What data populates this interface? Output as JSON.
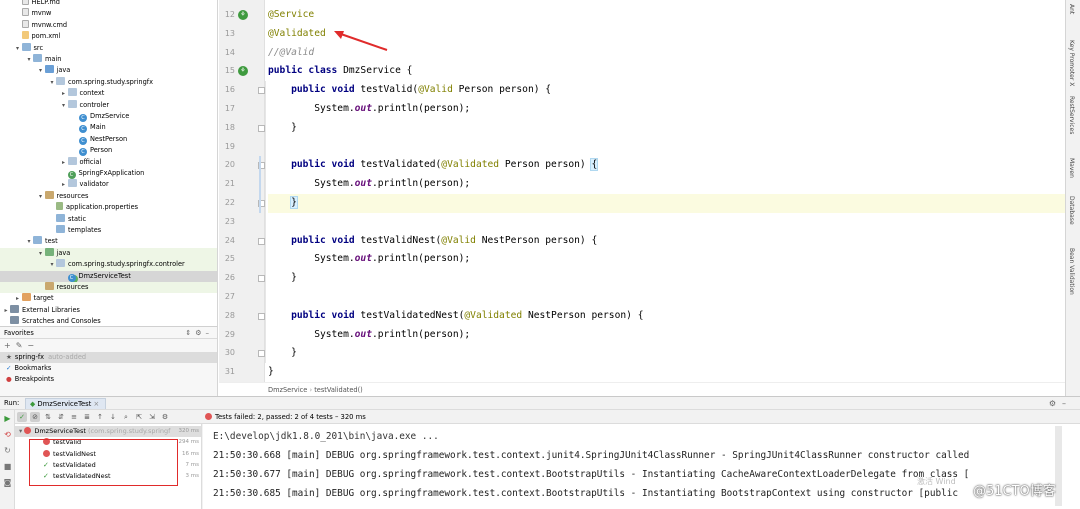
{
  "project_tree": [
    {
      "label": "HELP.md",
      "indent": 1,
      "icon": "file-icon",
      "arrow": ""
    },
    {
      "label": "mvnw",
      "indent": 1,
      "icon": "file-icon",
      "arrow": ""
    },
    {
      "label": "mvnw.cmd",
      "indent": 1,
      "icon": "file-icon",
      "arrow": ""
    },
    {
      "label": "pom.xml",
      "indent": 1,
      "icon": "xml-file-icon",
      "arrow": ""
    },
    {
      "label": "src",
      "indent": 1,
      "icon": "folder-icon",
      "arrow": "v"
    },
    {
      "label": "main",
      "indent": 2,
      "icon": "folder-icon",
      "arrow": "v"
    },
    {
      "label": "java",
      "indent": 3,
      "icon": "source-folder-icon",
      "arrow": "v"
    },
    {
      "label": "com.spring.study.springfx",
      "indent": 4,
      "icon": "package-icon",
      "arrow": "v"
    },
    {
      "label": "context",
      "indent": 5,
      "icon": "package-icon",
      "arrow": ">"
    },
    {
      "label": "controler",
      "indent": 5,
      "icon": "package-icon",
      "arrow": "v"
    },
    {
      "label": "DmzService",
      "indent": 6,
      "icon": "class-icon",
      "arrow": ""
    },
    {
      "label": "Main",
      "indent": 6,
      "icon": "class-icon",
      "arrow": ""
    },
    {
      "label": "NestPerson",
      "indent": 6,
      "icon": "class-icon",
      "arrow": ""
    },
    {
      "label": "Person",
      "indent": 6,
      "icon": "class-icon",
      "arrow": ""
    },
    {
      "label": "official",
      "indent": 5,
      "icon": "package-icon",
      "arrow": ">"
    },
    {
      "label": "SpringFxApplication",
      "indent": 5,
      "icon": "spring-class-icon",
      "arrow": ""
    },
    {
      "label": "validator",
      "indent": 5,
      "icon": "package-icon",
      "arrow": ">"
    },
    {
      "label": "resources",
      "indent": 3,
      "icon": "resources-folder-icon",
      "arrow": "v"
    },
    {
      "label": "application.properties",
      "indent": 4,
      "icon": "properties-file-icon",
      "arrow": ""
    },
    {
      "label": "static",
      "indent": 4,
      "icon": "folder-icon",
      "arrow": ""
    },
    {
      "label": "templates",
      "indent": 4,
      "icon": "folder-icon",
      "arrow": ""
    },
    {
      "label": "test",
      "indent": 2,
      "icon": "folder-icon",
      "arrow": "v"
    },
    {
      "label": "java",
      "indent": 3,
      "icon": "test-folder-icon",
      "arrow": "v",
      "highlight": "green"
    },
    {
      "label": "com.spring.study.springfx.controler",
      "indent": 4,
      "icon": "package-icon",
      "arrow": "v",
      "highlight": "green"
    },
    {
      "label": "DmzServiceTest",
      "indent": 5,
      "icon": "test-class-icon",
      "arrow": "",
      "highlight": "selected"
    },
    {
      "label": "resources",
      "indent": 3,
      "icon": "resources-folder-icon",
      "arrow": "",
      "highlight": "green"
    },
    {
      "label": "target",
      "indent": 1,
      "icon": "target-folder-icon",
      "arrow": ">"
    },
    {
      "label": "External Libraries",
      "indent": 0,
      "icon": "library-icon",
      "arrow": ">"
    },
    {
      "label": "Scratches and Consoles",
      "indent": 0,
      "icon": "scratches-icon",
      "arrow": ""
    }
  ],
  "favorites": {
    "title": "Favorites",
    "items": [
      {
        "label": "spring-fx",
        "suffix": "auto-added",
        "icon": "star-icon"
      },
      {
        "label": "Bookmarks",
        "suffix": "",
        "icon": "bookmark-check-icon"
      },
      {
        "label": "Breakpoints",
        "suffix": "",
        "icon": "breakpoint-icon"
      }
    ]
  },
  "editor": {
    "lines": [
      {
        "n": "12",
        "html": "<span class=\"ann\">@Service</span>"
      },
      {
        "n": "13",
        "html": "<span class=\"ann\">@Validated</span>"
      },
      {
        "n": "14",
        "html": "<span class=\"cmt\">//@Valid</span>"
      },
      {
        "n": "15",
        "html": "<span class=\"kw\">public class</span> DmzService {"
      },
      {
        "n": "16",
        "html": "    <span class=\"kw\">public void</span> testValid(<span class=\"ann\">@Valid</span> Person person) {"
      },
      {
        "n": "17",
        "html": "        System.<span class=\"fld\">out</span>.println(person);"
      },
      {
        "n": "18",
        "html": "    }"
      },
      {
        "n": "19",
        "html": ""
      },
      {
        "n": "20",
        "html": "    <span class=\"kw\">public void</span> testValidated(<span class=\"ann\">@Validated</span> Person person) <span class=\"brace-hl\">{</span>"
      },
      {
        "n": "21",
        "html": "        System.<span class=\"fld\">out</span>.println(person);"
      },
      {
        "n": "22",
        "html": "    <span class=\"brace-hl\">}</span>",
        "current": true
      },
      {
        "n": "23",
        "html": ""
      },
      {
        "n": "24",
        "html": "    <span class=\"kw\">public void</span> testValidNest(<span class=\"ann\">@Valid</span> NestPerson person) {"
      },
      {
        "n": "25",
        "html": "        System.<span class=\"fld\">out</span>.println(person);"
      },
      {
        "n": "26",
        "html": "    }"
      },
      {
        "n": "27",
        "html": ""
      },
      {
        "n": "28",
        "html": "    <span class=\"kw\">public void</span> testValidatedNest(<span class=\"ann\">@Validated</span> NestPerson person) {"
      },
      {
        "n": "29",
        "html": "        System.<span class=\"fld\">out</span>.println(person);"
      },
      {
        "n": "30",
        "html": "    }"
      },
      {
        "n": "31",
        "html": "}"
      }
    ],
    "breadcrumb": [
      "DmzService",
      "testValidated()"
    ]
  },
  "right_sidebar": [
    "Ant",
    "Key Promoter X",
    "RestServices",
    "Maven",
    "Database",
    "Bean Validation"
  ],
  "run_panel": {
    "label": "Run:",
    "tab_label": "DmzServiceTest",
    "status_text": "Tests failed: 2, passed: 2 of 4 tests – 320 ms",
    "tests": [
      {
        "label": "DmzServiceTest",
        "suffix": "(com.spring.study.springf",
        "time": "320 ms",
        "status": "fail",
        "root": true
      },
      {
        "label": "testValid",
        "time": "294 ms",
        "status": "fail"
      },
      {
        "label": "testValidNest",
        "time": "16 ms",
        "status": "fail"
      },
      {
        "label": "testValidated",
        "time": "7 ms",
        "status": "pass"
      },
      {
        "label": "testValidatedNest",
        "time": "3 ms",
        "status": "pass"
      }
    ],
    "console_lines": [
      "E:\\develop\\jdk1.8.0_201\\bin\\java.exe ...",
      "21:50:30.668 [main] DEBUG org.springframework.test.context.junit4.SpringJUnit4ClassRunner - SpringJUnit4ClassRunner constructor called",
      "21:50:30.677 [main] DEBUG org.springframework.test.context.BootstrapUtils - Instantiating CacheAwareContextLoaderDelegate from class [",
      "21:50:30.685 [main] DEBUG org.springframework.test.context.BootstrapUtils - Instantiating BootstrapContext using constructor [public"
    ]
  },
  "watermark": "激活 Wind",
  "site_mark": "@51CTO博客",
  "colors": {
    "annotation": "#808000",
    "keyword": "#000080",
    "field": "#660e7a",
    "fail": "#e05555",
    "pass": "#3c9a3c",
    "arrow": "#e02b2b"
  }
}
